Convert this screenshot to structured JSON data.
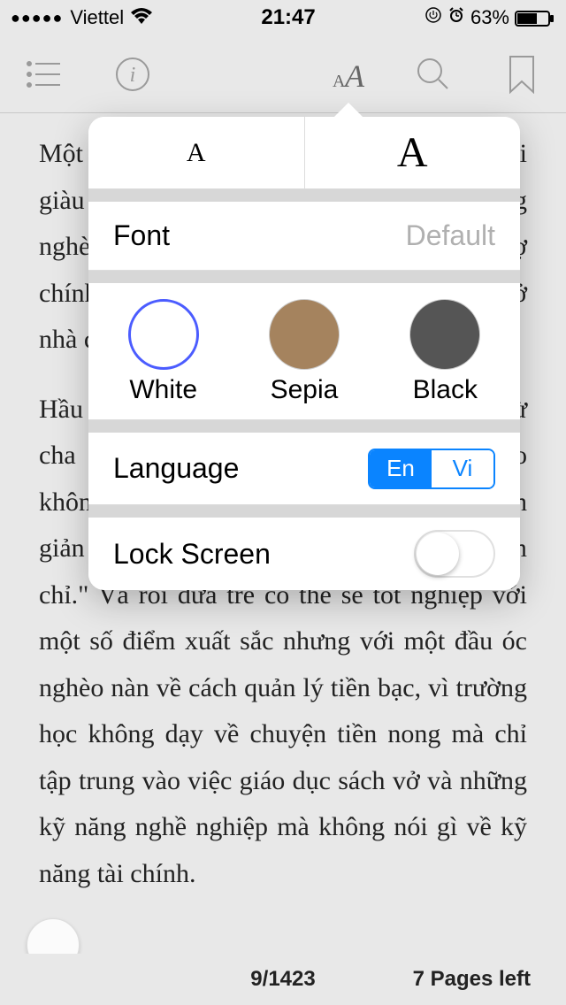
{
  "status": {
    "signal_dots": "●●●●●",
    "carrier": "Viettel",
    "time": "21:47",
    "battery_pct": "63%"
  },
  "reader_text": {
    "p1": "Một trong những nguyên nhân khiến người giàu ngày càng giàu, người nghèo ngày càng nghèo, còn giới trung lưu thì thường mắc nợ chính là vì chủ đề tiền bạc thường được dạy ở nhà chứ không phải ở trường.",
    "p2": "Hầu hết chúng ta học cách xử lý tiền bạc từ cha mẹ mình, và thường thì người nghèo không dạy con về tiền bạc mà chỉ nói đơn giản là: \"Hãy đến trường và học cho chăm chỉ.\" Và rồi đứa trẻ có thể sẽ tốt nghiệp với một số điểm xuất sắc nhưng với một đầu óc nghèo nàn về cách quản lý tiền bạc, vì trường học không dạy về chuyện tiền nong mà chỉ tập trung vào việc giáo dục sách vở và những kỹ năng nghề nghiệp mà không nói gì về kỹ năng tài chính."
  },
  "popover": {
    "size_small": "A",
    "size_large": "A",
    "font_label": "Font",
    "font_value": "Default",
    "themes": {
      "white": "White",
      "sepia": "Sepia",
      "black": "Black"
    },
    "language_label": "Language",
    "lang_en": "En",
    "lang_vi": "Vi",
    "lock_label": "Lock Screen"
  },
  "footer": {
    "position": "9/1423",
    "pages_left": "7 Pages left"
  }
}
